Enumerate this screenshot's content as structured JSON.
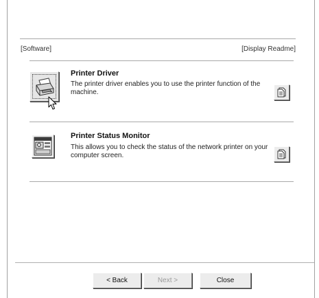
{
  "header": {
    "left_label": "[Software]",
    "right_label": "[Display Readme]"
  },
  "items": [
    {
      "title": "Printer Driver",
      "description": "The printer driver enables you to use the printer function of the machine.",
      "icon": "printer-icon",
      "readme_icon": "document-icon"
    },
    {
      "title": "Printer Status Monitor",
      "description": "This allows you to check the status of the network printer on your computer screen.",
      "icon": "status-monitor-icon",
      "readme_icon": "document-icon"
    }
  ],
  "footer": {
    "back_label": "< Back",
    "next_label": "Next >",
    "close_label": "Close"
  },
  "colors": {
    "background": "#ffffff",
    "button_face": "#ececec",
    "disabled_text": "#9a9a9a",
    "divider": "#a9a9a9"
  }
}
